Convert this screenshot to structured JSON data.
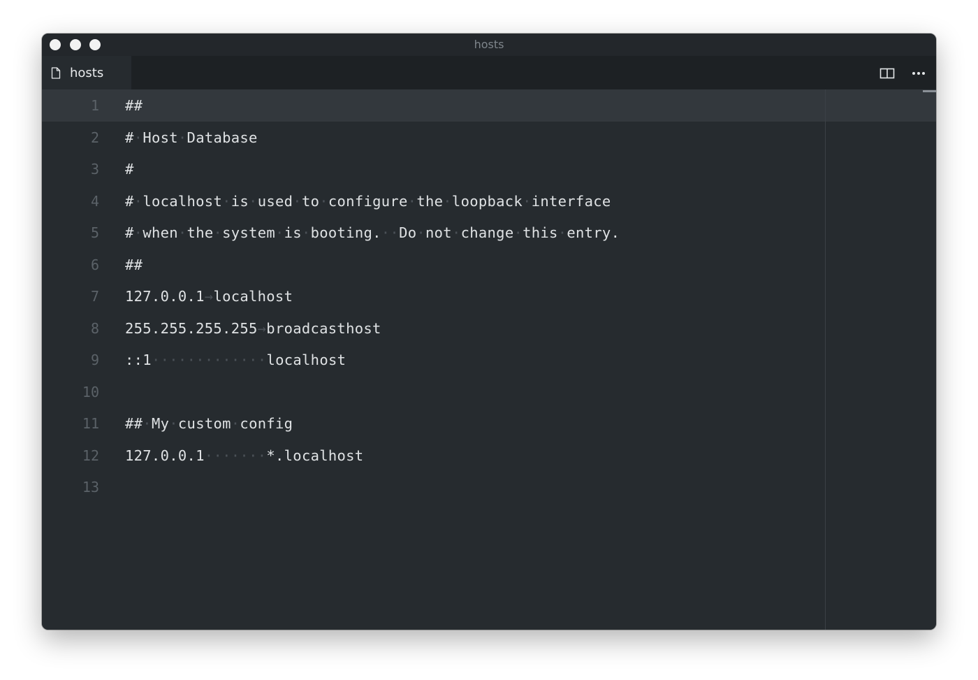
{
  "window": {
    "title": "hosts"
  },
  "tab": {
    "label": "hosts",
    "icon": "file-icon"
  },
  "toolbar": {
    "split_icon": "split-editor-icon",
    "more_icon": "more-actions-icon"
  },
  "editor": {
    "current_line": 1,
    "lines": [
      {
        "number": "1",
        "text": "##"
      },
      {
        "number": "2",
        "text": "# Host Database"
      },
      {
        "number": "3",
        "text": "#"
      },
      {
        "number": "4",
        "text": "# localhost is used to configure the loopback interface"
      },
      {
        "number": "5",
        "text": "# when the system is booting.  Do not change this entry."
      },
      {
        "number": "6",
        "text": "##"
      },
      {
        "number": "7",
        "text": "127.0.0.1\tlocalhost"
      },
      {
        "number": "8",
        "text": "255.255.255.255\tbroadcasthost"
      },
      {
        "number": "9",
        "text": "::1             localhost"
      },
      {
        "number": "10",
        "text": ""
      },
      {
        "number": "11",
        "text": "## My custom config"
      },
      {
        "number": "12",
        "text": "127.0.0.1       *.localhost"
      },
      {
        "number": "13",
        "text": ""
      }
    ]
  },
  "colors": {
    "background": "#262b2f",
    "tabbar": "#1d2124",
    "current_line": "#33383d",
    "text": "#dfe2e4",
    "line_number": "#5b6268",
    "whitespace": "#4b5157"
  }
}
